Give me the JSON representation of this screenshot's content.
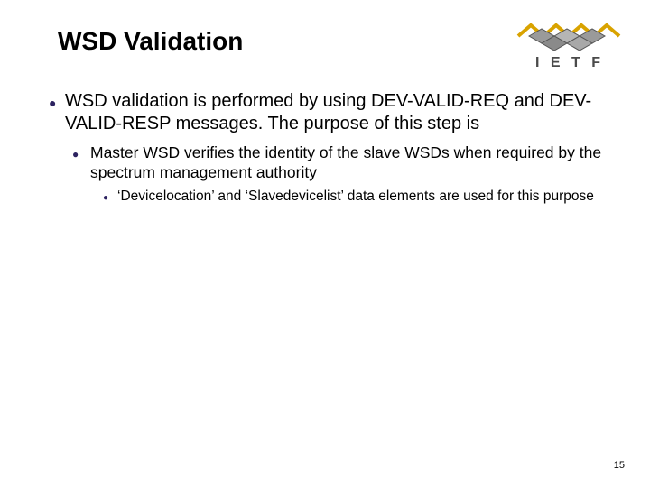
{
  "slide": {
    "title": "WSD Validation",
    "page_number": "15"
  },
  "logo": {
    "text": "I E T F"
  },
  "content": {
    "lvl1_text": "WSD validation is performed by using DEV-VALID-REQ and DEV-VALID-RESP messages. The purpose of this step is",
    "lvl2_text": " Master WSD verifies the identity of the slave WSDs when required by the spectrum management authority",
    "lvl3_text": "‘Devicelocation’  and ‘Slavedevicelist’ data elements are used for this purpose"
  }
}
